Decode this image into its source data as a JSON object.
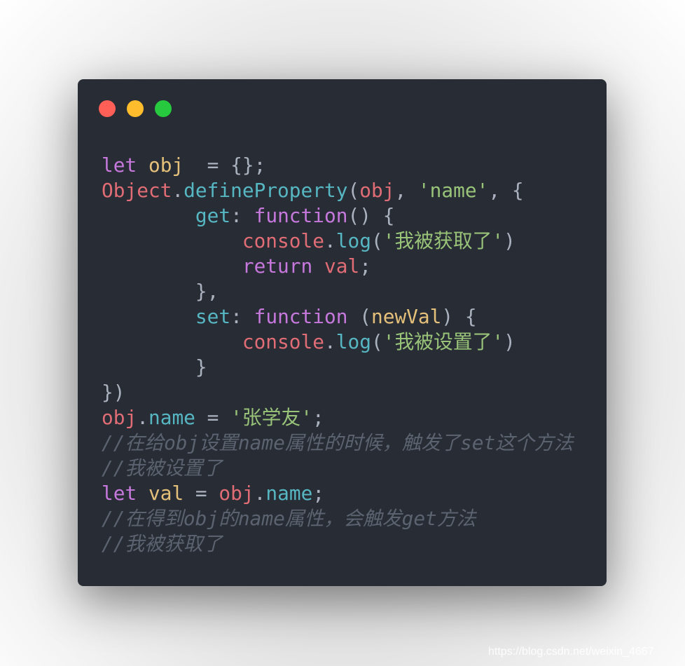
{
  "window": {
    "controls": [
      {
        "name": "close",
        "color": "#ff5f56"
      },
      {
        "name": "minimize",
        "color": "#ffbd2e"
      },
      {
        "name": "maximize",
        "color": "#27c93f"
      }
    ],
    "background": "#282c34"
  },
  "code": {
    "language": "javascript",
    "lines": [
      [
        [
          "kw",
          "let"
        ],
        [
          "pun",
          " "
        ],
        [
          "var",
          "obj"
        ],
        [
          "pun",
          "  = {};"
        ]
      ],
      [
        [
          "red",
          "Object"
        ],
        [
          "pun",
          "."
        ],
        [
          "cyan",
          "defineProperty"
        ],
        [
          "pun",
          "("
        ],
        [
          "red",
          "obj"
        ],
        [
          "pun",
          ", "
        ],
        [
          "str",
          "'name'"
        ],
        [
          "pun",
          ", {"
        ]
      ],
      [
        [
          "pun",
          "        "
        ],
        [
          "cyan",
          "get"
        ],
        [
          "pun",
          ": "
        ],
        [
          "kw",
          "function"
        ],
        [
          "pun",
          "() {"
        ]
      ],
      [
        [
          "pun",
          "            "
        ],
        [
          "red",
          "console"
        ],
        [
          "pun",
          "."
        ],
        [
          "cyan",
          "log"
        ],
        [
          "pun",
          "("
        ],
        [
          "str",
          "'我被获取了'"
        ],
        [
          "pun",
          ")"
        ]
      ],
      [
        [
          "pun",
          "            "
        ],
        [
          "kw",
          "return"
        ],
        [
          "pun",
          " "
        ],
        [
          "red",
          "val"
        ],
        [
          "pun",
          ";"
        ]
      ],
      [
        [
          "pun",
          "        },"
        ]
      ],
      [
        [
          "pun",
          "        "
        ],
        [
          "cyan",
          "set"
        ],
        [
          "pun",
          ": "
        ],
        [
          "kw",
          "function"
        ],
        [
          "pun",
          " ("
        ],
        [
          "var",
          "newVal"
        ],
        [
          "pun",
          ") {"
        ]
      ],
      [
        [
          "pun",
          "            "
        ],
        [
          "red",
          "console"
        ],
        [
          "pun",
          "."
        ],
        [
          "cyan",
          "log"
        ],
        [
          "pun",
          "("
        ],
        [
          "str",
          "'我被设置了'"
        ],
        [
          "pun",
          ")"
        ]
      ],
      [
        [
          "pun",
          "        }"
        ]
      ],
      [
        [
          "pun",
          "})"
        ]
      ],
      [
        [
          "red",
          "obj"
        ],
        [
          "pun",
          "."
        ],
        [
          "cyan",
          "name"
        ],
        [
          "pun",
          " = "
        ],
        [
          "str",
          "'张学友'"
        ],
        [
          "pun",
          ";"
        ]
      ],
      [
        [
          "com",
          "//在给obj设置name属性的时候，触发了set这个方法"
        ]
      ],
      [
        [
          "com",
          "//我被设置了"
        ]
      ],
      [
        [
          "kw",
          "let"
        ],
        [
          "pun",
          " "
        ],
        [
          "var",
          "val"
        ],
        [
          "pun",
          " = "
        ],
        [
          "red",
          "obj"
        ],
        [
          "pun",
          "."
        ],
        [
          "cyan",
          "name"
        ],
        [
          "pun",
          ";"
        ]
      ],
      [
        [
          "com",
          "//在得到obj的name属性，会触发get方法"
        ]
      ],
      [
        [
          "com",
          "//我被获取了"
        ]
      ]
    ]
  },
  "watermark": "https://blog.csdn.net/weixin_4667"
}
